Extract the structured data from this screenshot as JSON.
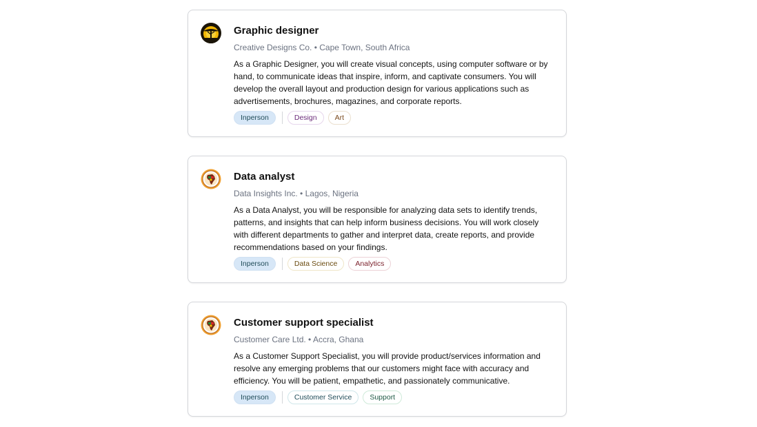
{
  "jobs": [
    {
      "title": "Graphic designer",
      "company": "Creative Designs Co.",
      "separator": " • ",
      "location": "Cape Town, South Africa",
      "description": "As a Graphic Designer, you will create visual concepts, using computer software or by hand, to communicate ideas that inspire, inform, and captivate consumers. You will develop the overall layout and production design for various applications such as advertisements, brochures, magazines, and corporate reports.",
      "work_mode": "Inperson",
      "logo_icon": "savanna-tree-logo-icon",
      "tags": [
        {
          "label": "Design",
          "color": "#6b2b7a",
          "border": "#e6d6ec"
        },
        {
          "label": "Art",
          "color": "#7a4a1e",
          "border": "#eadfce"
        }
      ]
    },
    {
      "title": "Data analyst",
      "company": "Data Insights Inc.",
      "separator": " • ",
      "location": "Lagos, Nigeria",
      "description": "As a Data Analyst, you will be responsible for analyzing data sets to identify trends, patterns, and insights that can help inform business decisions. You will work closely with different departments to gather and interpret data, create reports, and provide recommendations based on your findings.",
      "work_mode": "Inperson",
      "logo_icon": "africa-emblem-logo-icon",
      "tags": [
        {
          "label": "Data Science",
          "color": "#6a4b10",
          "border": "#efe6c8"
        },
        {
          "label": "Analytics",
          "color": "#7a1f2a",
          "border": "#ecd2d6"
        }
      ]
    },
    {
      "title": "Customer support specialist",
      "company": "Customer Care Ltd.",
      "separator": " • ",
      "location": "Accra, Ghana",
      "description": "As a Customer Support Specialist, you will provide product/services information and resolve any emerging problems that our customers might face with accuracy and efficiency. You will be patient, empathetic, and passionately communicative.",
      "work_mode": "Inperson",
      "logo_icon": "africa-emblem-logo-icon",
      "tags": [
        {
          "label": "Customer Service",
          "color": "#1f4b58",
          "border": "#cfe6ea"
        },
        {
          "label": "Support",
          "color": "#1f5a45",
          "border": "#cfead9"
        }
      ]
    }
  ]
}
